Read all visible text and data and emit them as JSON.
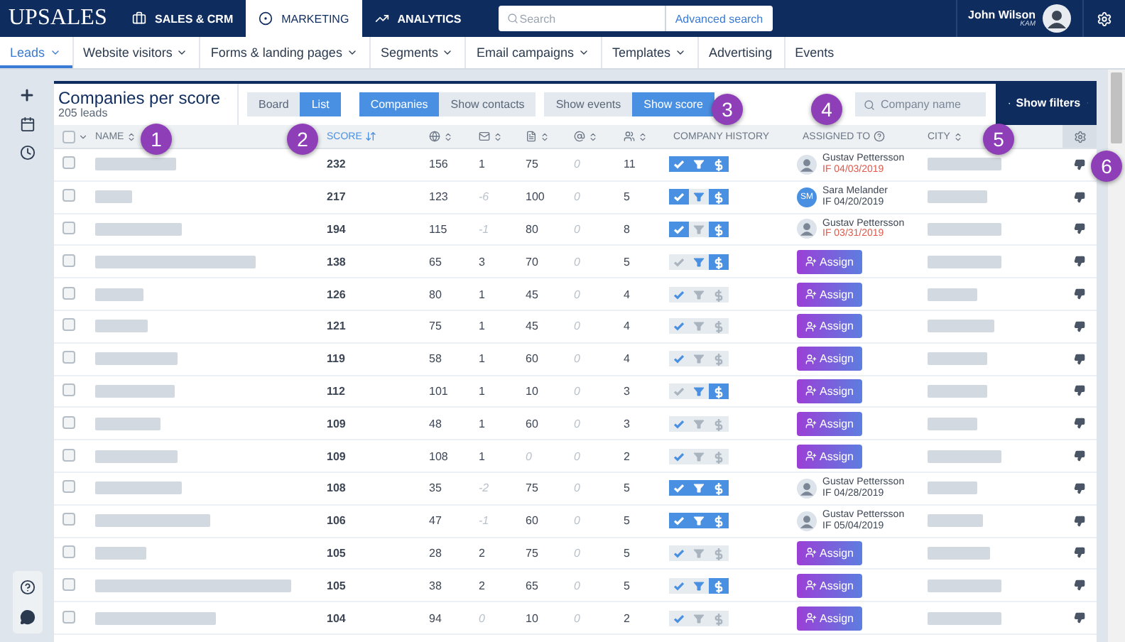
{
  "brand": "UPSALES",
  "main_tabs": [
    {
      "label": "SALES & CRM",
      "selected": false
    },
    {
      "label": "MARKETING",
      "selected": true
    },
    {
      "label": "ANALYTICS",
      "selected": false
    }
  ],
  "search": {
    "placeholder": "Search",
    "advanced": "Advanced search"
  },
  "user": {
    "name": "John Wilson",
    "role": "KAM"
  },
  "sub_nav": [
    {
      "label": "Leads",
      "dropdown": true,
      "selected": true
    },
    {
      "label": "Website visitors",
      "dropdown": true,
      "selected": false
    },
    {
      "label": "Forms & landing pages",
      "dropdown": true,
      "selected": false
    },
    {
      "label": "Segments",
      "dropdown": true,
      "selected": false
    },
    {
      "label": "Email campaigns",
      "dropdown": true,
      "selected": false
    },
    {
      "label": "Templates",
      "dropdown": true,
      "selected": false
    },
    {
      "label": "Advertising",
      "dropdown": false,
      "selected": false
    },
    {
      "label": "Events",
      "dropdown": false,
      "selected": false
    }
  ],
  "list_header": {
    "title": "Companies per score",
    "count": "205 leads"
  },
  "toggle_groups": [
    [
      {
        "label": "Board",
        "selected": false
      },
      {
        "label": "List",
        "selected": true
      }
    ],
    [
      {
        "label": "Companies",
        "selected": true
      },
      {
        "label": "Show contacts",
        "selected": false
      }
    ],
    [
      {
        "label": "Show events",
        "selected": false
      },
      {
        "label": "Show score",
        "selected": true
      }
    ]
  ],
  "company_search": {
    "placeholder": "Company name"
  },
  "filters_button": "Show filters",
  "columns": {
    "name": "NAME",
    "score": "SCORE",
    "history": "COMPANY HISTORY",
    "assigned": "ASSIGNED TO",
    "city": "CITY"
  },
  "select_all": {
    "checked": false
  },
  "rows": [
    {
      "checked": false,
      "score": "232",
      "metrics": [
        {
          "value": "156",
          "muted": false
        },
        {
          "value": "1",
          "muted": false
        },
        {
          "value": "75",
          "muted": false
        },
        {
          "value": "0",
          "muted": true
        },
        {
          "value": "11",
          "muted": false
        }
      ],
      "history": [
        {
          "filled": true,
          "lit": true
        },
        {
          "filled": true,
          "lit": true
        },
        {
          "filled": true,
          "lit": true
        }
      ],
      "assigned": {
        "kind": "user",
        "avatar": {
          "kind": "photo"
        },
        "name": "Gustav Pettersson",
        "date": "IF 04/03/2019",
        "overdue": true
      }
    },
    {
      "checked": false,
      "score": "217",
      "metrics": [
        {
          "value": "123",
          "muted": false
        },
        {
          "value": "-6",
          "muted": true
        },
        {
          "value": "100",
          "muted": false
        },
        {
          "value": "0",
          "muted": true
        },
        {
          "value": "5",
          "muted": false
        }
      ],
      "history": [
        {
          "filled": true,
          "lit": true
        },
        {
          "filled": false,
          "lit": true
        },
        {
          "filled": true,
          "lit": true
        }
      ],
      "assigned": {
        "kind": "user",
        "avatar": {
          "kind": "initials",
          "text": "SM"
        },
        "name": "Sara Melander",
        "date": "IF 04/20/2019",
        "overdue": false
      }
    },
    {
      "checked": false,
      "score": "194",
      "metrics": [
        {
          "value": "115",
          "muted": false
        },
        {
          "value": "-1",
          "muted": true
        },
        {
          "value": "80",
          "muted": false
        },
        {
          "value": "0",
          "muted": true
        },
        {
          "value": "8",
          "muted": false
        }
      ],
      "history": [
        {
          "filled": true,
          "lit": true
        },
        {
          "filled": false,
          "lit": false
        },
        {
          "filled": true,
          "lit": true
        }
      ],
      "assigned": {
        "kind": "user",
        "avatar": {
          "kind": "photo"
        },
        "name": "Gustav Pettersson",
        "date": "IF 03/31/2019",
        "overdue": true
      }
    },
    {
      "checked": false,
      "score": "138",
      "metrics": [
        {
          "value": "65",
          "muted": false
        },
        {
          "value": "3",
          "muted": false
        },
        {
          "value": "70",
          "muted": false
        },
        {
          "value": "0",
          "muted": true
        },
        {
          "value": "5",
          "muted": false
        }
      ],
      "history": [
        {
          "filled": false,
          "lit": false
        },
        {
          "filled": false,
          "lit": true
        },
        {
          "filled": true,
          "lit": true
        }
      ],
      "assigned": {
        "kind": "button",
        "label": "Assign"
      }
    },
    {
      "checked": false,
      "score": "126",
      "metrics": [
        {
          "value": "80",
          "muted": false
        },
        {
          "value": "1",
          "muted": false
        },
        {
          "value": "45",
          "muted": false
        },
        {
          "value": "0",
          "muted": true
        },
        {
          "value": "4",
          "muted": false
        }
      ],
      "history": [
        {
          "filled": false,
          "lit": true
        },
        {
          "filled": false,
          "lit": false
        },
        {
          "filled": false,
          "lit": false
        }
      ],
      "assigned": {
        "kind": "button",
        "label": "Assign"
      }
    },
    {
      "checked": false,
      "score": "121",
      "metrics": [
        {
          "value": "75",
          "muted": false
        },
        {
          "value": "1",
          "muted": false
        },
        {
          "value": "45",
          "muted": false
        },
        {
          "value": "0",
          "muted": true
        },
        {
          "value": "4",
          "muted": false
        }
      ],
      "history": [
        {
          "filled": false,
          "lit": true
        },
        {
          "filled": false,
          "lit": false
        },
        {
          "filled": false,
          "lit": false
        }
      ],
      "assigned": {
        "kind": "button",
        "label": "Assign"
      }
    },
    {
      "checked": false,
      "score": "119",
      "metrics": [
        {
          "value": "58",
          "muted": false
        },
        {
          "value": "1",
          "muted": false
        },
        {
          "value": "60",
          "muted": false
        },
        {
          "value": "0",
          "muted": true
        },
        {
          "value": "4",
          "muted": false
        }
      ],
      "history": [
        {
          "filled": false,
          "lit": true
        },
        {
          "filled": false,
          "lit": false
        },
        {
          "filled": false,
          "lit": false
        }
      ],
      "assigned": {
        "kind": "button",
        "label": "Assign"
      }
    },
    {
      "checked": false,
      "score": "112",
      "metrics": [
        {
          "value": "101",
          "muted": false
        },
        {
          "value": "1",
          "muted": false
        },
        {
          "value": "10",
          "muted": false
        },
        {
          "value": "0",
          "muted": true
        },
        {
          "value": "3",
          "muted": false
        }
      ],
      "history": [
        {
          "filled": false,
          "lit": false
        },
        {
          "filled": false,
          "lit": true
        },
        {
          "filled": true,
          "lit": true
        }
      ],
      "assigned": {
        "kind": "button",
        "label": "Assign"
      }
    },
    {
      "checked": false,
      "score": "109",
      "metrics": [
        {
          "value": "48",
          "muted": false
        },
        {
          "value": "1",
          "muted": false
        },
        {
          "value": "60",
          "muted": false
        },
        {
          "value": "0",
          "muted": true
        },
        {
          "value": "3",
          "muted": false
        }
      ],
      "history": [
        {
          "filled": false,
          "lit": true
        },
        {
          "filled": false,
          "lit": false
        },
        {
          "filled": false,
          "lit": false
        }
      ],
      "assigned": {
        "kind": "button",
        "label": "Assign"
      }
    },
    {
      "checked": false,
      "score": "109",
      "metrics": [
        {
          "value": "108",
          "muted": false
        },
        {
          "value": "1",
          "muted": false
        },
        {
          "value": "0",
          "muted": true
        },
        {
          "value": "0",
          "muted": true
        },
        {
          "value": "2",
          "muted": false
        }
      ],
      "history": [
        {
          "filled": false,
          "lit": true
        },
        {
          "filled": false,
          "lit": false
        },
        {
          "filled": false,
          "lit": false
        }
      ],
      "assigned": {
        "kind": "button",
        "label": "Assign"
      }
    },
    {
      "checked": false,
      "score": "108",
      "metrics": [
        {
          "value": "35",
          "muted": false
        },
        {
          "value": "-2",
          "muted": true
        },
        {
          "value": "75",
          "muted": false
        },
        {
          "value": "0",
          "muted": true
        },
        {
          "value": "5",
          "muted": false
        }
      ],
      "history": [
        {
          "filled": true,
          "lit": true
        },
        {
          "filled": true,
          "lit": true
        },
        {
          "filled": true,
          "lit": true
        }
      ],
      "assigned": {
        "kind": "user",
        "avatar": {
          "kind": "photo"
        },
        "name": "Gustav Pettersson",
        "date": "IF 04/28/2019",
        "overdue": false
      }
    },
    {
      "checked": false,
      "score": "106",
      "metrics": [
        {
          "value": "47",
          "muted": false
        },
        {
          "value": "-1",
          "muted": true
        },
        {
          "value": "60",
          "muted": false
        },
        {
          "value": "0",
          "muted": true
        },
        {
          "value": "5",
          "muted": false
        }
      ],
      "history": [
        {
          "filled": true,
          "lit": true
        },
        {
          "filled": true,
          "lit": true
        },
        {
          "filled": true,
          "lit": true
        }
      ],
      "assigned": {
        "kind": "user",
        "avatar": {
          "kind": "photo"
        },
        "name": "Gustav Pettersson",
        "date": "IF 05/04/2019",
        "overdue": false
      }
    },
    {
      "checked": false,
      "score": "105",
      "metrics": [
        {
          "value": "28",
          "muted": false
        },
        {
          "value": "2",
          "muted": false
        },
        {
          "value": "75",
          "muted": false
        },
        {
          "value": "0",
          "muted": true
        },
        {
          "value": "5",
          "muted": false
        }
      ],
      "history": [
        {
          "filled": false,
          "lit": true
        },
        {
          "filled": false,
          "lit": false
        },
        {
          "filled": false,
          "lit": false
        }
      ],
      "assigned": {
        "kind": "button",
        "label": "Assign"
      }
    },
    {
      "checked": false,
      "score": "105",
      "metrics": [
        {
          "value": "38",
          "muted": false
        },
        {
          "value": "2",
          "muted": false
        },
        {
          "value": "65",
          "muted": false
        },
        {
          "value": "0",
          "muted": true
        },
        {
          "value": "5",
          "muted": false
        }
      ],
      "history": [
        {
          "filled": false,
          "lit": true
        },
        {
          "filled": false,
          "lit": true
        },
        {
          "filled": true,
          "lit": true
        }
      ],
      "assigned": {
        "kind": "button",
        "label": "Assign"
      }
    },
    {
      "checked": false,
      "score": "104",
      "metrics": [
        {
          "value": "94",
          "muted": false
        },
        {
          "value": "0",
          "muted": true
        },
        {
          "value": "10",
          "muted": false
        },
        {
          "value": "0",
          "muted": true
        },
        {
          "value": "2",
          "muted": false
        }
      ],
      "history": [
        {
          "filled": false,
          "lit": true
        },
        {
          "filled": false,
          "lit": false
        },
        {
          "filled": false,
          "lit": false
        }
      ],
      "assigned": {
        "kind": "button",
        "label": "Assign"
      }
    }
  ],
  "callouts": [
    "1",
    "2",
    "3",
    "4",
    "5",
    "6"
  ]
}
